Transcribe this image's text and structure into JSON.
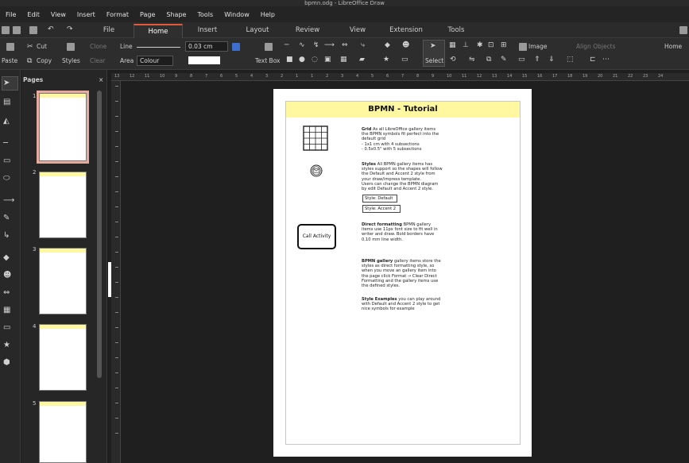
{
  "window": {
    "title": "bpmn.odg - LibreOffice Draw"
  },
  "menu": [
    "File",
    "Edit",
    "View",
    "Insert",
    "Format",
    "Page",
    "Shape",
    "Tools",
    "Window",
    "Help"
  ],
  "tabs": [
    "File",
    "Home",
    "Insert",
    "Layout",
    "Review",
    "View",
    "Extension",
    "Tools"
  ],
  "active_tab": "Home",
  "toolbar": {
    "cut": "Cut",
    "clone": "Clone",
    "paste": "Paste",
    "copy": "Copy",
    "clear": "Clear",
    "styles": "Styles",
    "line_label": "Line",
    "area_label": "Area",
    "area_value": "Colour",
    "line_width": "0.03 cm",
    "text_box": "Text Box",
    "select": "Select",
    "image": "Image",
    "align_objects": "Align Objects",
    "home": "Home"
  },
  "sidebar": {
    "title": "Pages",
    "pages": [
      "1",
      "2",
      "3",
      "4",
      "5"
    ]
  },
  "ruler": {
    "ticks": [
      "13",
      "12",
      "11",
      "10",
      "9",
      "8",
      "7",
      "6",
      "5",
      "4",
      "3",
      "2",
      "1",
      "1",
      "2",
      "3",
      "4",
      "5",
      "6",
      "7",
      "8",
      "9",
      "10",
      "11",
      "12",
      "13",
      "14",
      "15",
      "16",
      "17",
      "18",
      "19",
      "20",
      "21",
      "22",
      "23",
      "24"
    ]
  },
  "document": {
    "title": "BPMN - Tutorial",
    "grid": {
      "heading": "Grid",
      "text": "As all LibreOffice gallery items the BPMN symbols fit perfect into the default grid\n- 1x1 cm with 4 subsections\n- 0.5x0.5\" with 5 subsections"
    },
    "styles": {
      "heading": "Styles",
      "text": "All BPMN gallery items has styles support so the shapes will follow the Default and Accent 2 style from your draw/impress template.\nUsers can change the BPMN diagram by edit Default and Accent 2 style."
    },
    "style_default": "Style: Default",
    "style_accent": "Style: Accent 2",
    "call_activity": "Call Activity",
    "direct": {
      "heading": "Direct formatting",
      "text": "BPMN gallery items use 11px font size to fit well in writer and draw. Bold borders have 0,10 mm line width."
    },
    "gallery": {
      "heading": "BPMN gallery",
      "text": "gallery items store the styles as direct formatting style, so when you move an gallery item into the page click Format → Clear Direct Formatting and the gallery items use the defined styles."
    },
    "examples": {
      "heading": "Style Examples",
      "text": "you can play around with Default and Accent 2 style to get nice symbols for example"
    }
  }
}
